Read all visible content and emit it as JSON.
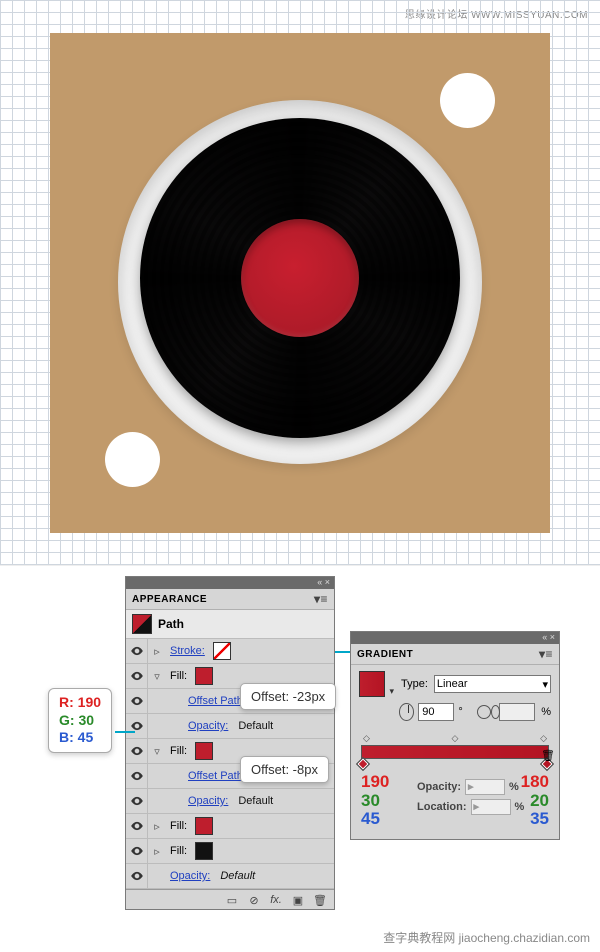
{
  "header": {
    "site_label": "思缘设计论坛 WWW.MISSYUAN.COM"
  },
  "appearance": {
    "title": "APPEARANCE",
    "object_type": "Path",
    "stroke_label": "Stroke:",
    "fill_label": "Fill:",
    "offset_path_label": "Offset Path",
    "opacity_label": "Opacity:",
    "opacity_value": "Default",
    "offset1_callout": "Offset: -23px",
    "offset2_callout": "Offset: -8px"
  },
  "rgb_callout": {
    "r_label": "R: 190",
    "g_label": "G: 30",
    "b_label": "B: 45"
  },
  "gradient": {
    "title": "GRADIENT",
    "type_label": "Type:",
    "type_value": "Linear",
    "angle_value": "90",
    "ratio_value": "",
    "opacity_label": "Opacity:",
    "location_label": "Location:",
    "left_stop": {
      "r": "190",
      "g": "30",
      "b": "45"
    },
    "right_stop": {
      "r": "180",
      "g": "20",
      "b": "35"
    },
    "percent": "%"
  },
  "watermark": "查字典教程网 jiaocheng.chazidian.com"
}
